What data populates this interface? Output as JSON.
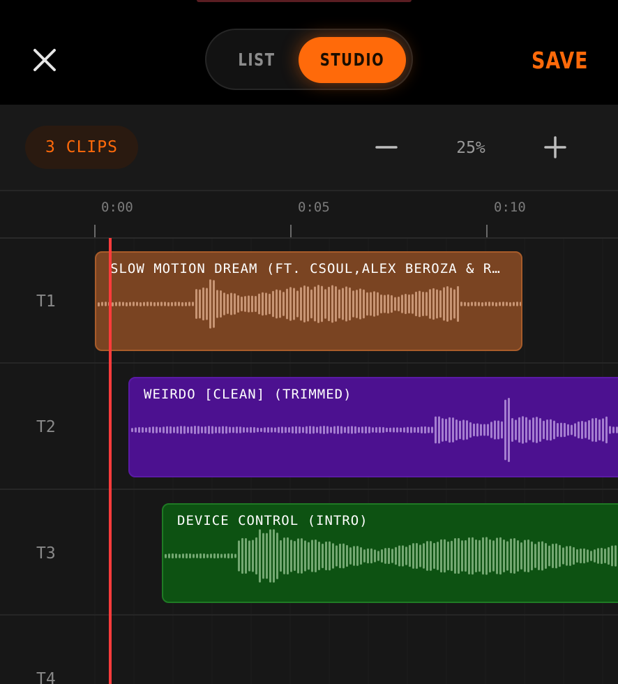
{
  "header": {
    "toggle": {
      "list_label": "LIST",
      "studio_label": "STUDIO",
      "active": "STUDIO"
    },
    "save_label": "SAVE"
  },
  "toolbar": {
    "clip_count_label": "3 CLIPS",
    "zoom_level": "25%"
  },
  "ruler": {
    "ticks": [
      "0:00",
      "0:05",
      "0:10"
    ]
  },
  "tracks": [
    {
      "label": "T1"
    },
    {
      "label": "T2"
    },
    {
      "label": "T3"
    },
    {
      "label": "T4"
    }
  ],
  "clips": [
    {
      "track": "T1",
      "title": "SLOW MOTION DREAM (FT. CSOUL,ALEX BEROZA & R…",
      "color": "#7a4422",
      "wave_color": "#c89574"
    },
    {
      "track": "T2",
      "title": "WEIRDO [CLEAN] (TRIMMED)",
      "color": "#4c1190",
      "wave_color": "#a57ed0"
    },
    {
      "track": "T3",
      "title": "DEVICE CONTROL (INTRO)",
      "color": "#0d5212",
      "wave_color": "#74a872"
    }
  ],
  "colors": {
    "accent": "#ff6a0a",
    "playhead": "#ff3b3b"
  }
}
